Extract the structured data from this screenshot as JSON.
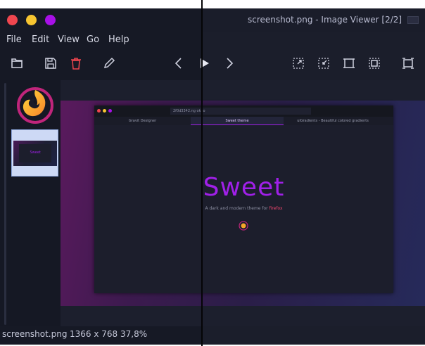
{
  "window": {
    "title": "screenshot.png - Image Viewer [2/2]"
  },
  "menu": {
    "items": [
      "File",
      "Edit",
      "View",
      "Go",
      "Help"
    ]
  },
  "toolbar": {
    "icons": [
      "folder-icon",
      "save-icon",
      "delete-icon",
      "edit-icon",
      "previous-icon",
      "play-icon",
      "next-icon",
      "fit-icon",
      "shrink-icon",
      "original-size-icon",
      "zoom-fit-icon",
      "fullscreen-icon"
    ]
  },
  "image": {
    "browser_url": "2f0d3342.ng ok.io",
    "tabs": [
      "Gravit Designer",
      "Sweet theme",
      "uiGradients - Beautiful colored gradients"
    ],
    "headline": "Sweet",
    "tagline_prefix": "A dark and modern theme for ",
    "tagline_highlight": "firefox",
    "thumb_label": "Sweet"
  },
  "status": {
    "filename": "screenshot.png",
    "dimensions": "1366 x 768",
    "zoom": "37,8%"
  },
  "colors": {
    "accent": "#a020e8",
    "close": "#f0464f",
    "minimize": "#f7c531",
    "maximize": "#a810e8",
    "highlight": "#f0466f"
  }
}
